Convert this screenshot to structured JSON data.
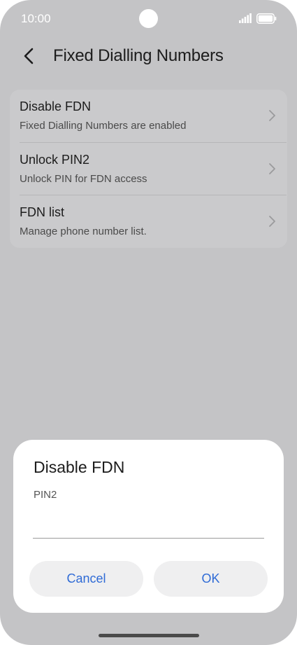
{
  "status_bar": {
    "time": "10:00",
    "icons": [
      "camera-cutout",
      "signal-icon",
      "battery-icon"
    ]
  },
  "app_bar": {
    "back_icon": "chevron-left-icon",
    "title": "Fixed Dialling Numbers"
  },
  "settings": {
    "items": [
      {
        "title": "Disable FDN",
        "subtitle": "Fixed Dialling Numbers are enabled",
        "icon": "chevron-right-icon"
      },
      {
        "title": "Unlock PIN2",
        "subtitle": "Unlock PIN for FDN access",
        "icon": "chevron-right-icon"
      },
      {
        "title": "FDN list",
        "subtitle": "Manage phone number list.",
        "icon": "chevron-right-icon"
      }
    ]
  },
  "dialog": {
    "title": "Disable FDN",
    "field_label": "PIN2",
    "field_value": "",
    "cancel_label": "Cancel",
    "ok_label": "OK"
  },
  "colors": {
    "accent": "#2f6bd6",
    "background_dimmed": "#c4c4c6",
    "card": "#cacacc",
    "dialog": "#ffffff"
  }
}
